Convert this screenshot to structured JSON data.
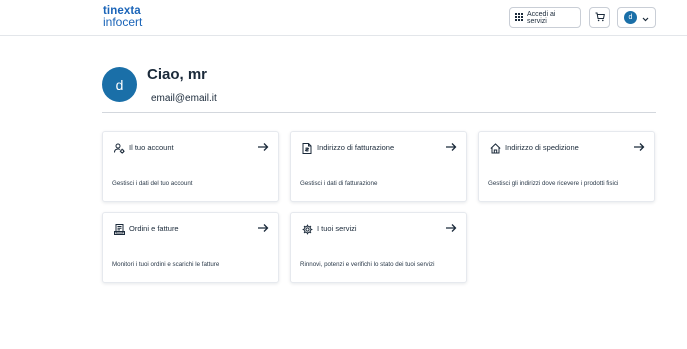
{
  "header": {
    "logo_line1": "tinexta",
    "logo_line2": "infocert",
    "services_label": "Accedi ai servizi",
    "user_initial": "d"
  },
  "profile": {
    "initial": "d",
    "greeting": "Ciao, mr",
    "email": "email@email.it"
  },
  "cards": [
    {
      "title": "Il tuo account",
      "desc": "Gestisci i dati del tuo account",
      "icon": "user-gear-icon"
    },
    {
      "title": "Indirizzo di fatturazione",
      "desc": "Gestisci i dati di fatturazione",
      "icon": "invoice-icon"
    },
    {
      "title": "Indirizzo di spedizione",
      "desc": "Gestisci gli indirizzi dove ricevere i prodotti fisici",
      "icon": "home-icon"
    },
    {
      "title": "Ordini e fatture",
      "desc": "Monitori i tuoi ordini e scarichi le fatture",
      "icon": "orders-icon"
    },
    {
      "title": "I tuoi servizi",
      "desc": "Rinnovi, potenzi e verifichi lo stato dei tuoi servizi",
      "icon": "gear-icon"
    }
  ],
  "colors": {
    "brand": "#1a64b8",
    "avatar": "#1a6fa8",
    "text": "#1b2a3a"
  }
}
